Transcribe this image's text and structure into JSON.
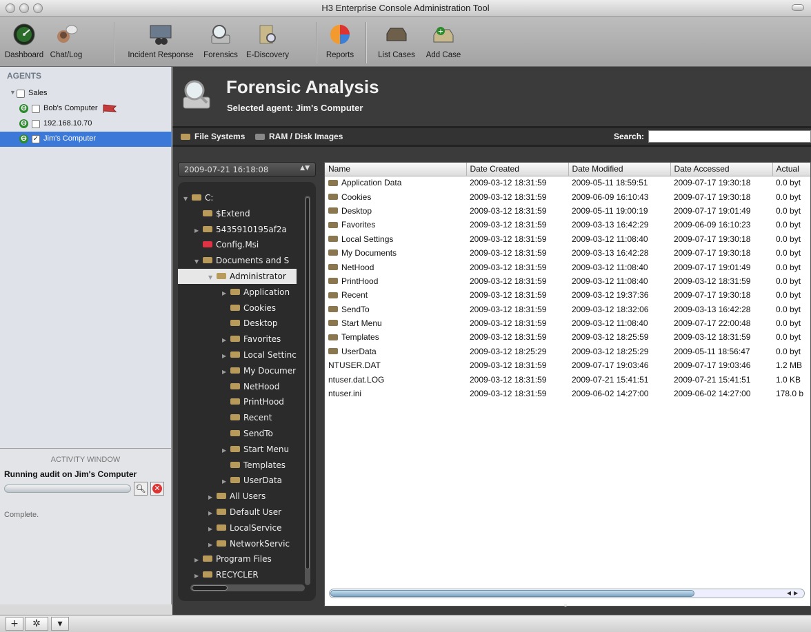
{
  "window": {
    "title": "H3 Enterprise Console Administration Tool"
  },
  "toolbar": {
    "items": [
      {
        "label": "Dashboard",
        "icon": "dashboard-icon"
      },
      {
        "label": "Chat/Log",
        "icon": "chat-log-icon"
      },
      {
        "label": "Incident Response",
        "icon": "incident-response-icon"
      },
      {
        "label": "Forensics",
        "icon": "forensics-icon"
      },
      {
        "label": "E-Discovery",
        "icon": "e-discovery-icon"
      },
      {
        "label": "Reports",
        "icon": "reports-pie-icon"
      },
      {
        "label": "List Cases",
        "icon": "list-cases-icon"
      },
      {
        "label": "Add Case",
        "icon": "add-case-icon"
      }
    ]
  },
  "sidebar": {
    "heading": "AGENTS",
    "agents": [
      {
        "label": "Sales",
        "checked": false
      },
      {
        "label": "Bob's Computer",
        "checked": false
      },
      {
        "label": "192.168.10.70",
        "checked": false
      },
      {
        "label": "Jim's Computer",
        "checked": true
      }
    ]
  },
  "activity": {
    "heading": "ACTIVITY WINDOW",
    "task": "Running audit on Jim's Computer",
    "status": "Complete."
  },
  "header": {
    "title": "Forensic Analysis",
    "subtitle": "Selected agent: Jim's Computer"
  },
  "subbar": {
    "tab_file_systems": "File Systems",
    "tab_ram": "RAM / Disk Images",
    "search_label": "Search:",
    "search_value": ""
  },
  "snapshot": {
    "selected": "2009-07-21 16:18:08"
  },
  "tree": [
    {
      "label": "C:",
      "depth": 0,
      "expanded": true
    },
    {
      "label": "$Extend",
      "depth": 1
    },
    {
      "label": "5435910195af2a",
      "depth": 1,
      "collapsed": true
    },
    {
      "label": "Config.Msi",
      "depth": 1,
      "red": true
    },
    {
      "label": "Documents and S",
      "depth": 1,
      "expanded": true
    },
    {
      "label": "Administrator",
      "depth": 2,
      "expanded": true,
      "selected": true
    },
    {
      "label": "Application",
      "depth": 3,
      "collapsed": true
    },
    {
      "label": "Cookies",
      "depth": 3
    },
    {
      "label": "Desktop",
      "depth": 3
    },
    {
      "label": "Favorites",
      "depth": 3,
      "collapsed": true
    },
    {
      "label": "Local Settinc",
      "depth": 3,
      "collapsed": true
    },
    {
      "label": "My Documer",
      "depth": 3,
      "collapsed": true
    },
    {
      "label": "NetHood",
      "depth": 3
    },
    {
      "label": "PrintHood",
      "depth": 3
    },
    {
      "label": "Recent",
      "depth": 3
    },
    {
      "label": "SendTo",
      "depth": 3
    },
    {
      "label": "Start Menu",
      "depth": 3,
      "collapsed": true
    },
    {
      "label": "Templates",
      "depth": 3
    },
    {
      "label": "UserData",
      "depth": 3,
      "collapsed": true
    },
    {
      "label": "All Users",
      "depth": 2,
      "collapsed": true
    },
    {
      "label": "Default User",
      "depth": 2,
      "collapsed": true
    },
    {
      "label": "LocalService",
      "depth": 2,
      "collapsed": true
    },
    {
      "label": "NetworkServic",
      "depth": 2,
      "collapsed": true
    },
    {
      "label": "Program Files",
      "depth": 1,
      "collapsed": true
    },
    {
      "label": "RECYCLER",
      "depth": 1,
      "collapsed": true
    }
  ],
  "files": {
    "columns": [
      "Name",
      "Date Created",
      "Date Modified",
      "Date Accessed",
      "Actual"
    ],
    "rows": [
      {
        "name": "Application Data",
        "folder": true,
        "created": "2009-03-12 18:31:59",
        "modified": "2009-05-11 18:59:51",
        "accessed": "2009-07-17 19:30:18",
        "size": "0.0 byt"
      },
      {
        "name": "Cookies",
        "folder": true,
        "created": "2009-03-12 18:31:59",
        "modified": "2009-06-09 16:10:43",
        "accessed": "2009-07-17 19:30:18",
        "size": "0.0 byt"
      },
      {
        "name": "Desktop",
        "folder": true,
        "created": "2009-03-12 18:31:59",
        "modified": "2009-05-11 19:00:19",
        "accessed": "2009-07-17 19:01:49",
        "size": "0.0 byt"
      },
      {
        "name": "Favorites",
        "folder": true,
        "created": "2009-03-12 18:31:59",
        "modified": "2009-03-13 16:42:29",
        "accessed": "2009-06-09 16:10:23",
        "size": "0.0 byt"
      },
      {
        "name": "Local Settings",
        "folder": true,
        "created": "2009-03-12 18:31:59",
        "modified": "2009-03-12 11:08:40",
        "accessed": "2009-07-17 19:30:18",
        "size": "0.0 byt"
      },
      {
        "name": "My Documents",
        "folder": true,
        "created": "2009-03-12 18:31:59",
        "modified": "2009-03-13 16:42:28",
        "accessed": "2009-07-17 19:30:18",
        "size": "0.0 byt"
      },
      {
        "name": "NetHood",
        "folder": true,
        "created": "2009-03-12 18:31:59",
        "modified": "2009-03-12 11:08:40",
        "accessed": "2009-07-17 19:01:49",
        "size": "0.0 byt"
      },
      {
        "name": "PrintHood",
        "folder": true,
        "created": "2009-03-12 18:31:59",
        "modified": "2009-03-12 11:08:40",
        "accessed": "2009-03-12 18:31:59",
        "size": "0.0 byt"
      },
      {
        "name": "Recent",
        "folder": true,
        "created": "2009-03-12 18:31:59",
        "modified": "2009-03-12 19:37:36",
        "accessed": "2009-07-17 19:30:18",
        "size": "0.0 byt"
      },
      {
        "name": "SendTo",
        "folder": true,
        "created": "2009-03-12 18:31:59",
        "modified": "2009-03-12 18:32:06",
        "accessed": "2009-03-13 16:42:28",
        "size": "0.0 byt"
      },
      {
        "name": "Start Menu",
        "folder": true,
        "created": "2009-03-12 18:31:59",
        "modified": "2009-03-12 11:08:40",
        "accessed": "2009-07-17 22:00:48",
        "size": "0.0 byt"
      },
      {
        "name": "Templates",
        "folder": true,
        "created": "2009-03-12 18:31:59",
        "modified": "2009-03-12 18:25:59",
        "accessed": "2009-03-12 18:31:59",
        "size": "0.0 byt"
      },
      {
        "name": "UserData",
        "folder": true,
        "created": "2009-03-12 18:25:29",
        "modified": "2009-03-12 18:25:29",
        "accessed": "2009-05-11 18:56:47",
        "size": "0.0 byt"
      },
      {
        "name": "NTUSER.DAT",
        "folder": false,
        "created": "2009-03-12 18:31:59",
        "modified": "2009-07-17 19:03:46",
        "accessed": "2009-07-17 19:03:46",
        "size": "1.2 MB"
      },
      {
        "name": "ntuser.dat.LOG",
        "folder": false,
        "created": "2009-03-12 18:31:59",
        "modified": "2009-07-21 15:41:51",
        "accessed": "2009-07-21 15:41:51",
        "size": "1.0 KB"
      },
      {
        "name": "ntuser.ini",
        "folder": false,
        "created": "2009-03-12 18:31:59",
        "modified": "2009-06-02 14:27:00",
        "accessed": "2009-06-02 14:27:00",
        "size": "178.0 b"
      }
    ]
  },
  "bottombar": {
    "add": "+",
    "gear": "✲",
    "menu": "▾"
  }
}
